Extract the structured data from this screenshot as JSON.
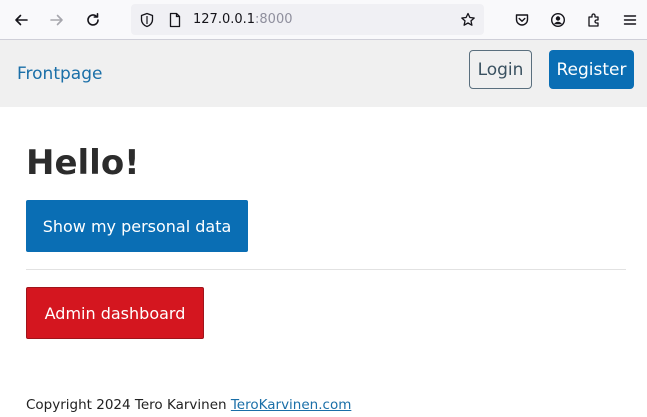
{
  "browser": {
    "url_host": "127.0.0.1",
    "url_port": ":8000",
    "icons": [
      "back-icon",
      "forward-icon",
      "reload-icon",
      "shield-icon",
      "page-icon",
      "bookmark-star-icon",
      "pocket-icon",
      "account-icon",
      "extensions-icon",
      "menu-icon"
    ]
  },
  "nav": {
    "brand": "Frontpage",
    "login_label": "Login",
    "register_label": "Register"
  },
  "main": {
    "title": "Hello!",
    "personal_data_label": "Show my personal data",
    "admin_label": "Admin dashboard"
  },
  "footer": {
    "copyright": "Copyright 2024 Tero Karvinen",
    "link_label": "TeroKarvinen.com"
  },
  "colors": {
    "primary": "#0a6eb4",
    "danger": "#d4161f",
    "link": "#1a6fa8",
    "nav_bg": "#f0f0f0"
  }
}
